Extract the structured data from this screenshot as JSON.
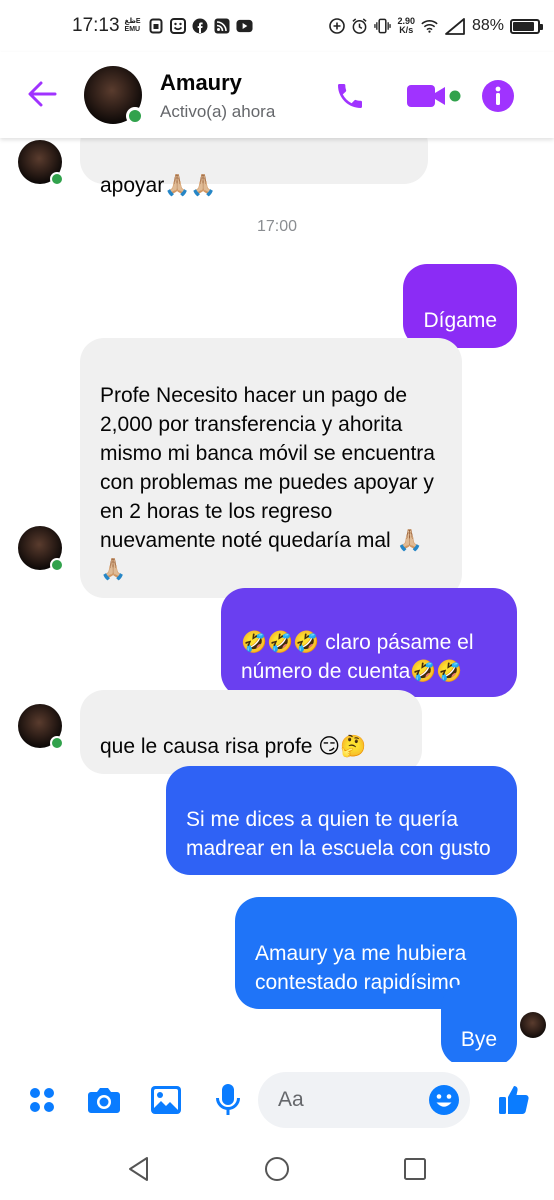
{
  "status_bar": {
    "time": "17:13",
    "carrier_text": "ظغE EMU",
    "net_speed_value": "2.90",
    "net_speed_unit": "K/s",
    "battery_percent": "88%",
    "battery_level": 0.88
  },
  "header": {
    "contact_name": "Amaury",
    "status": "Activo(a) ahora",
    "accent_color": "#a033ff"
  },
  "messages": [
    {
      "sender": "contact",
      "text": "apoyar🙏🏼🙏🏼"
    },
    {
      "timestamp": "17:00"
    },
    {
      "sender": "me",
      "text": "Dígame"
    },
    {
      "sender": "contact",
      "text": "Profe Necesito hacer un pago de 2,000 por transferencia y ahorita mismo mi banca móvil se encuentra con problemas me puedes apoyar y en 2 horas te los regreso nuevamente noté quedaría mal 🙏🏼🙏🏼"
    },
    {
      "sender": "me",
      "text": "🤣🤣🤣 claro pásame el número de cuenta🤣🤣"
    },
    {
      "sender": "contact",
      "text": "que le causa risa profe 😏🤔"
    },
    {
      "sender": "me",
      "text": "Si me dices a quien te quería madrear en la escuela con gusto"
    },
    {
      "sender": "me",
      "text": "Amaury ya me hubiera contestado rapidísimo"
    },
    {
      "sender": "me",
      "text": "Bye"
    }
  ],
  "composer": {
    "placeholder": "Aa",
    "icon_color": "#0a7cff"
  },
  "icons": {
    "header": [
      "back-arrow-icon",
      "phone-icon",
      "video-camera-icon",
      "info-icon"
    ],
    "composer": [
      "menu-dots-icon",
      "camera-icon",
      "gallery-icon",
      "microphone-icon",
      "emoji-icon",
      "thumbs-up-icon"
    ],
    "nav": [
      "nav-back-icon",
      "nav-home-icon",
      "nav-recents-icon"
    ]
  },
  "colors": {
    "incoming_bubble": "#f0f0f0",
    "outgoing_purple": "#8b2cf5",
    "outgoing_violet": "#6a3ff0",
    "outgoing_blue": "#2f62f5",
    "outgoing_blue_light": "#1f74f8",
    "active_green": "#31a24c"
  }
}
